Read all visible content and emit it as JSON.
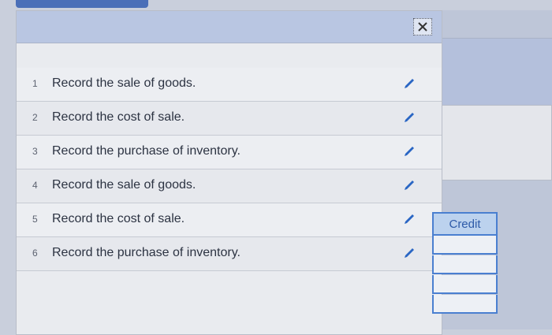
{
  "header": {
    "close_icon": "close-x-icon"
  },
  "rows": [
    {
      "num": "1",
      "label": "Record the sale of goods."
    },
    {
      "num": "2",
      "label": "Record the cost of sale."
    },
    {
      "num": "3",
      "label": "Record the purchase of inventory."
    },
    {
      "num": "4",
      "label": "Record the sale of goods."
    },
    {
      "num": "5",
      "label": "Record the cost of sale."
    },
    {
      "num": "6",
      "label": "Record the purchase of inventory."
    }
  ],
  "journal": {
    "credit_label": "Credit"
  },
  "colors": {
    "accent": "#4a7fd0",
    "edit_icon": "#2a66c4"
  }
}
